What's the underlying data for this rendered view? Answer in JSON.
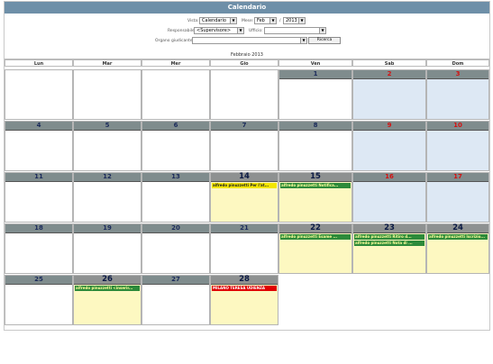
{
  "window": {
    "title": "Calendario"
  },
  "filters": {
    "vista_label": "Vista:",
    "vista_value": "Calendario",
    "mese_label": "Mese:",
    "mese_value": "Feb",
    "anno_separator": "/",
    "anno_value": "2013",
    "responsabile_label": "Responsabile:",
    "responsabile_value": "<Supervisore>",
    "ufficio_label": "Ufficio:",
    "ufficio_value": "",
    "organo_label": "Organo giudicante:",
    "organo_value": "",
    "search_button": "Ricerca"
  },
  "calendar": {
    "month_title": "Febbraio 2013",
    "weekdays": [
      "Lun",
      "Mar",
      "Mer",
      "Gio",
      "Ven",
      "Sab",
      "Dom"
    ],
    "weeks": [
      [
        {
          "day": ""
        },
        {
          "day": ""
        },
        {
          "day": ""
        },
        {
          "day": ""
        },
        {
          "day": "1"
        },
        {
          "day": "2",
          "weekend": true
        },
        {
          "day": "3",
          "weekend": true
        }
      ],
      [
        {
          "day": "4"
        },
        {
          "day": "5"
        },
        {
          "day": "6"
        },
        {
          "day": "7"
        },
        {
          "day": "8"
        },
        {
          "day": "9",
          "weekend": true
        },
        {
          "day": "10",
          "weekend": true
        }
      ],
      [
        {
          "day": "11"
        },
        {
          "day": "12"
        },
        {
          "day": "13"
        },
        {
          "day": "14",
          "events": [
            {
              "text": "alfredo pinuzzetti Per l'at...",
              "color": "yellow"
            }
          ]
        },
        {
          "day": "15",
          "events": [
            {
              "text": "alfredo pinuzzetti Notifica...",
              "color": "green"
            }
          ]
        },
        {
          "day": "16",
          "weekend": true
        },
        {
          "day": "17",
          "weekend": true
        }
      ],
      [
        {
          "day": "18"
        },
        {
          "day": "19"
        },
        {
          "day": "20"
        },
        {
          "day": "21"
        },
        {
          "day": "22",
          "events": [
            {
              "text": "alfredo pinuzzetti Esame ...",
              "color": "green"
            }
          ]
        },
        {
          "day": "23",
          "events": [
            {
              "text": "alfredo pinuzzetti Ritiro d...",
              "color": "green"
            },
            {
              "text": "alfredo pinuzzetti Nota di ...",
              "color": "green"
            }
          ]
        },
        {
          "day": "24",
          "events": [
            {
              "text": "alfredo pinuzzetti Iscrizio...",
              "color": "green"
            }
          ]
        }
      ],
      [
        {
          "day": "25"
        },
        {
          "day": "26",
          "events": [
            {
              "text": "alfredo pinuzzetti <inserir...",
              "color": "green"
            }
          ]
        },
        {
          "day": "27"
        },
        {
          "day": "28",
          "events": [
            {
              "text": "MILANO TERESA UDIENZA",
              "color": "red"
            }
          ]
        }
      ]
    ]
  }
}
